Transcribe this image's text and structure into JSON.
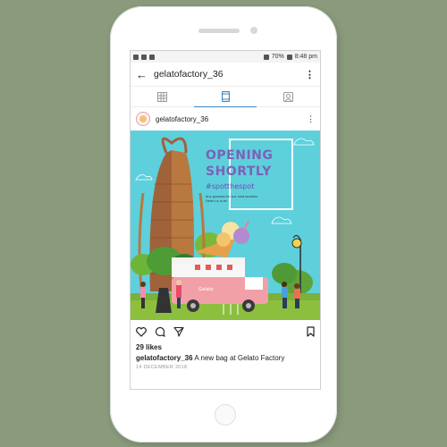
{
  "statusbar": {
    "battery": "70%",
    "time": "8:48 pm"
  },
  "appbar": {
    "back_icon": "arrow-left-icon",
    "title": "gelatofactory_36",
    "more_icon": "more-vertical-icon"
  },
  "tabs": [
    {
      "icon": "grid-icon",
      "active": false
    },
    {
      "icon": "feed-icon",
      "active": true
    },
    {
      "icon": "tagged-icon",
      "active": false
    }
  ],
  "post": {
    "username": "gelatofactory_36",
    "image": {
      "headline_1": "OPENING",
      "headline_2": "SHORTLY",
      "hashtag": "#spotthespot",
      "subtext_1": "Any guesses for our new location",
      "subtext_2": "Here's a clue!",
      "truck_sign": "Gelato"
    },
    "likes": "29 likes",
    "caption_user": "gelatofactory_36",
    "caption_text": " A new bag at Gelato Factory",
    "date": "14 DECEMBER 2018"
  },
  "colors": {
    "sky": "#5dd0dc",
    "headline": "#7b62b8",
    "grass": "#8dbf3f",
    "truck": "#f2a0a8"
  }
}
